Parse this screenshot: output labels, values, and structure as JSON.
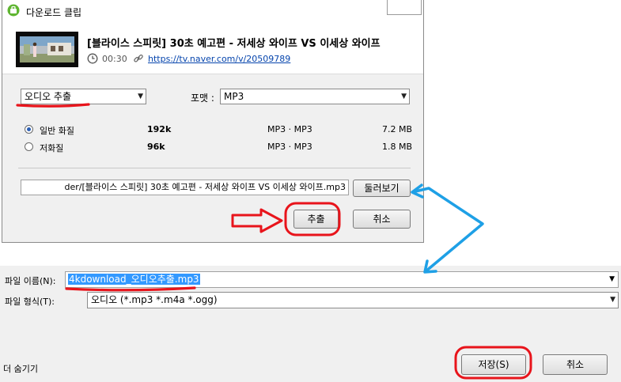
{
  "download_dialog": {
    "title": "다운로드 클립",
    "video_title": "[블라이스 스피릿] 30초 예고편 - 저세상 와이프 VS 이세상 와이프",
    "duration": "00:30",
    "url": "https://tv.naver.com/v/20509789",
    "mode": "오디오 추출",
    "format_label": "포맷 :",
    "format": "MP3",
    "options": [
      {
        "label": "일반 화질",
        "bitrate": "192k",
        "codec": "MP3 · MP3",
        "size": "7.2 MB",
        "selected": true
      },
      {
        "label": "저화질",
        "bitrate": "96k",
        "codec": "MP3 · MP3",
        "size": "1.8 MB",
        "selected": false
      }
    ],
    "path": "der/[블라이스 스피릿] 30초 예고편 - 저세상 와이프 VS 이세상 와이프.mp3",
    "browse_label": "둘러보기",
    "extract_label": "추출",
    "cancel_label": "취소"
  },
  "save_dialog": {
    "filename_label": "파일 이름(N):",
    "filename": "4kdownload_오디오추출.mp3",
    "filetype_label": "파일 형식(T):",
    "filetype": "오디오 (*.mp3 *.m4a *.ogg)",
    "hide_folders_label": "더 숨기기",
    "save_label": "저장(S)",
    "cancel_label": "취소"
  },
  "colors": {
    "annotation_red": "#e8141b",
    "annotation_blue": "#1ea0e6",
    "selection": "#3399ff",
    "link": "#0645ad"
  },
  "icons": [
    "app-icon",
    "clock-icon",
    "link-icon",
    "chevron-down-icon"
  ]
}
